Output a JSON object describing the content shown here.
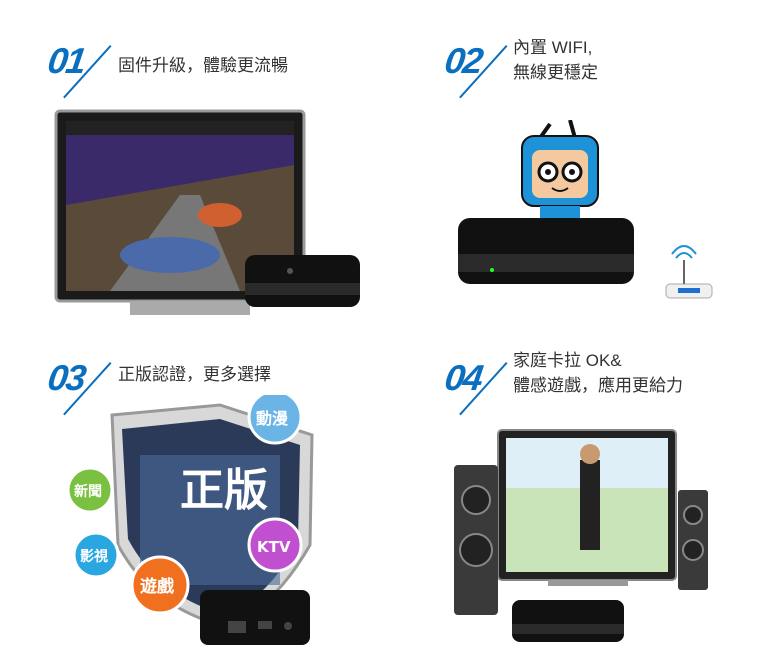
{
  "features": [
    {
      "number": "01",
      "lines": [
        "固件升級，體驗更流暢"
      ]
    },
    {
      "number": "02",
      "lines": [
        "內置 WIFI,",
        "無線更穩定"
      ]
    },
    {
      "number": "03",
      "lines": [
        "正版認證，更多選擇"
      ]
    },
    {
      "number": "04",
      "lines": [
        "家庭卡拉 OK&",
        "體感遊戲，應用更給力"
      ]
    }
  ],
  "badges": {
    "main": "正版",
    "anime": "動漫",
    "news": "新聞",
    "ktv": "KTV",
    "film": "影視",
    "games": "遊戲"
  },
  "icons": [
    "tv-icon",
    "set-top-box-icon",
    "mascot-icon",
    "router-icon",
    "shield-icon",
    "speaker-icon"
  ],
  "colors": {
    "accent": "#0b6fc0",
    "text": "#333333"
  }
}
